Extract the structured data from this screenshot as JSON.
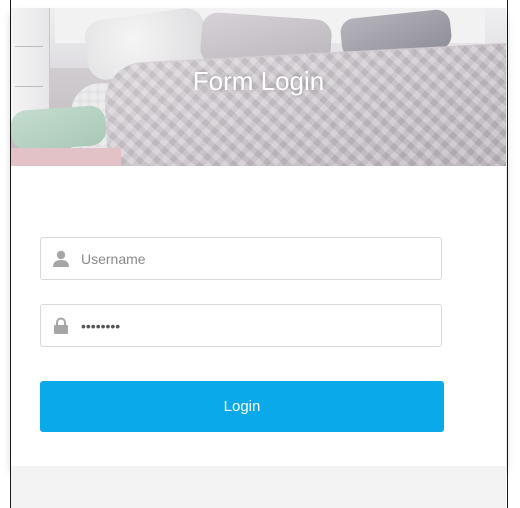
{
  "header": {
    "title": "Form Login"
  },
  "form": {
    "username": {
      "placeholder": "Username",
      "value": "",
      "icon": "user-icon"
    },
    "password": {
      "placeholder": "",
      "value": "••••••••",
      "icon": "lock-icon"
    },
    "login_label": "Login"
  },
  "colors": {
    "accent": "#0aa9e9",
    "field_border": "#d9d9d9",
    "icon": "#a6a6a6"
  }
}
